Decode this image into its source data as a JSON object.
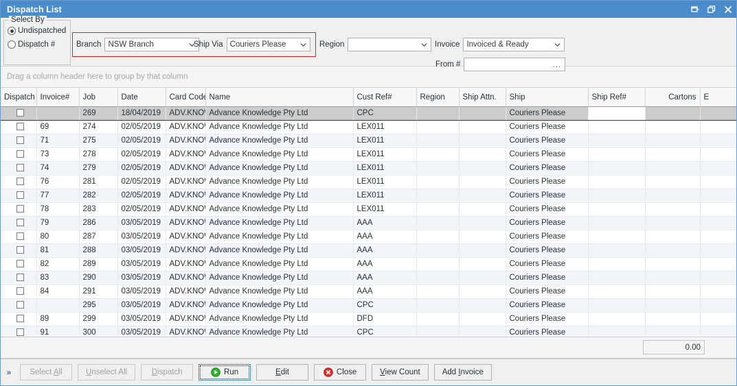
{
  "window": {
    "title": "Dispatch List",
    "controls": [
      {
        "name": "pin-icon",
        "label": "Pin"
      },
      {
        "name": "restore-icon",
        "label": "Restore"
      },
      {
        "name": "close-icon",
        "label": "Close"
      }
    ],
    "titlebar_color": "#4a8ccc"
  },
  "filters": {
    "select_by": {
      "legend": "Select By",
      "options": [
        {
          "label": "Undispatched",
          "checked": true
        },
        {
          "label": "Dispatch #",
          "checked": false
        }
      ]
    },
    "highlight_color": "#e02222",
    "branch": {
      "label": "Branch",
      "value": "NSW Branch"
    },
    "ship_via": {
      "label": "Ship Via",
      "value": "Couriers Please"
    },
    "region": {
      "label": "Region",
      "value": ""
    },
    "invoice": {
      "label": "Invoice",
      "value": "Invoiced & Ready"
    },
    "from_no": {
      "label": "From #",
      "value": "",
      "button": "..."
    }
  },
  "group_panel": {
    "hint": "Drag a column header here to group by that column"
  },
  "grid": {
    "columns": [
      {
        "key": "dispatch",
        "label": "Dispatch",
        "align": "left"
      },
      {
        "key": "invoice",
        "label": "Invoice#",
        "align": "left"
      },
      {
        "key": "job",
        "label": "Job",
        "align": "left"
      },
      {
        "key": "date",
        "label": "Date",
        "align": "left"
      },
      {
        "key": "card_code",
        "label": "Card Code",
        "align": "left"
      },
      {
        "key": "name",
        "label": "Name",
        "align": "left"
      },
      {
        "key": "cust_ref",
        "label": "Cust Ref#",
        "align": "left"
      },
      {
        "key": "region",
        "label": "Region",
        "align": "left"
      },
      {
        "key": "ship_attn",
        "label": "Ship Attn.",
        "align": "left"
      },
      {
        "key": "ship",
        "label": "Ship",
        "align": "left"
      },
      {
        "key": "ship_ref",
        "label": "Ship Ref#",
        "align": "left"
      },
      {
        "key": "cartons",
        "label": "Cartons",
        "align": "right"
      },
      {
        "key": "extra",
        "label": "E",
        "align": "left"
      }
    ],
    "rows": [
      {
        "selected": true,
        "checked": false,
        "invoice": "",
        "job": "269",
        "date": "18/04/2019",
        "card_code": "ADV.KNOW",
        "name": "Advance Knowledge Pty Ltd",
        "cust_ref": "CPC",
        "region": "",
        "ship_attn": "",
        "ship": "Couriers Please",
        "ship_ref": "",
        "cartons": "",
        "extra": ""
      },
      {
        "selected": false,
        "checked": false,
        "invoice": "69",
        "job": "274",
        "date": "02/05/2019",
        "card_code": "ADV.KNOW",
        "name": "Advance Knowledge Pty Ltd",
        "cust_ref": "LEX011",
        "region": "",
        "ship_attn": "",
        "ship": "Couriers Please",
        "ship_ref": "",
        "cartons": "",
        "extra": ""
      },
      {
        "selected": false,
        "checked": false,
        "invoice": "71",
        "job": "275",
        "date": "02/05/2019",
        "card_code": "ADV.KNOW",
        "name": "Advance Knowledge Pty Ltd",
        "cust_ref": "LEX011",
        "region": "",
        "ship_attn": "",
        "ship": "Couriers Please",
        "ship_ref": "",
        "cartons": "",
        "extra": ""
      },
      {
        "selected": false,
        "checked": false,
        "invoice": "73",
        "job": "278",
        "date": "02/05/2019",
        "card_code": "ADV.KNOW",
        "name": "Advance Knowledge Pty Ltd",
        "cust_ref": "LEX011",
        "region": "",
        "ship_attn": "",
        "ship": "Couriers Please",
        "ship_ref": "",
        "cartons": "",
        "extra": ""
      },
      {
        "selected": false,
        "checked": false,
        "invoice": "74",
        "job": "279",
        "date": "02/05/2019",
        "card_code": "ADV.KNOW",
        "name": "Advance Knowledge Pty Ltd",
        "cust_ref": "LEX011",
        "region": "",
        "ship_attn": "",
        "ship": "Couriers Please",
        "ship_ref": "",
        "cartons": "",
        "extra": ""
      },
      {
        "selected": false,
        "checked": false,
        "invoice": "76",
        "job": "281",
        "date": "02/05/2019",
        "card_code": "ADV.KNOW",
        "name": "Advance Knowledge Pty Ltd",
        "cust_ref": "LEX011",
        "region": "",
        "ship_attn": "",
        "ship": "Couriers Please",
        "ship_ref": "",
        "cartons": "",
        "extra": ""
      },
      {
        "selected": false,
        "checked": false,
        "invoice": "77",
        "job": "282",
        "date": "02/05/2019",
        "card_code": "ADV.KNOW",
        "name": "Advance Knowledge Pty Ltd",
        "cust_ref": "LEX011",
        "region": "",
        "ship_attn": "",
        "ship": "Couriers Please",
        "ship_ref": "",
        "cartons": "",
        "extra": ""
      },
      {
        "selected": false,
        "checked": false,
        "invoice": "78",
        "job": "283",
        "date": "02/05/2019",
        "card_code": "ADV.KNOW",
        "name": "Advance Knowledge Pty Ltd",
        "cust_ref": "LEX011",
        "region": "",
        "ship_attn": "",
        "ship": "Couriers Please",
        "ship_ref": "",
        "cartons": "",
        "extra": ""
      },
      {
        "selected": false,
        "checked": false,
        "invoice": "79",
        "job": "286",
        "date": "03/05/2019",
        "card_code": "ADV.KNOW",
        "name": "Advance Knowledge Pty Ltd",
        "cust_ref": "AAA",
        "region": "",
        "ship_attn": "",
        "ship": "Couriers Please",
        "ship_ref": "",
        "cartons": "",
        "extra": ""
      },
      {
        "selected": false,
        "checked": false,
        "invoice": "80",
        "job": "287",
        "date": "03/05/2019",
        "card_code": "ADV.KNOW",
        "name": "Advance Knowledge Pty Ltd",
        "cust_ref": "AAA",
        "region": "",
        "ship_attn": "",
        "ship": "Couriers Please",
        "ship_ref": "",
        "cartons": "",
        "extra": ""
      },
      {
        "selected": false,
        "checked": false,
        "invoice": "81",
        "job": "288",
        "date": "03/05/2019",
        "card_code": "ADV.KNOW",
        "name": "Advance Knowledge Pty Ltd",
        "cust_ref": "AAA",
        "region": "",
        "ship_attn": "",
        "ship": "Couriers Please",
        "ship_ref": "",
        "cartons": "",
        "extra": ""
      },
      {
        "selected": false,
        "checked": false,
        "invoice": "82",
        "job": "289",
        "date": "03/05/2019",
        "card_code": "ADV.KNOW",
        "name": "Advance Knowledge Pty Ltd",
        "cust_ref": "AAA",
        "region": "",
        "ship_attn": "",
        "ship": "Couriers Please",
        "ship_ref": "",
        "cartons": "",
        "extra": ""
      },
      {
        "selected": false,
        "checked": false,
        "invoice": "83",
        "job": "290",
        "date": "03/05/2019",
        "card_code": "ADV.KNOW",
        "name": "Advance Knowledge Pty Ltd",
        "cust_ref": "AAA",
        "region": "",
        "ship_attn": "",
        "ship": "Couriers Please",
        "ship_ref": "",
        "cartons": "",
        "extra": ""
      },
      {
        "selected": false,
        "checked": false,
        "invoice": "84",
        "job": "291",
        "date": "03/05/2019",
        "card_code": "ADV.KNOW",
        "name": "Advance Knowledge Pty Ltd",
        "cust_ref": "AAA",
        "region": "",
        "ship_attn": "",
        "ship": "Couriers Please",
        "ship_ref": "",
        "cartons": "",
        "extra": ""
      },
      {
        "selected": false,
        "checked": false,
        "invoice": "",
        "job": "295",
        "date": "03/05/2019",
        "card_code": "ADV.KNOW",
        "name": "Advance Knowledge Pty Ltd",
        "cust_ref": "CPC",
        "region": "",
        "ship_attn": "",
        "ship": "Couriers Please",
        "ship_ref": "",
        "cartons": "",
        "extra": ""
      },
      {
        "selected": false,
        "checked": false,
        "invoice": "89",
        "job": "299",
        "date": "03/05/2019",
        "card_code": "ADV.KNOW",
        "name": "Advance Knowledge Pty Ltd",
        "cust_ref": "DFD",
        "region": "",
        "ship_attn": "",
        "ship": "Couriers Please",
        "ship_ref": "",
        "cartons": "",
        "extra": ""
      },
      {
        "selected": false,
        "checked": false,
        "invoice": "91",
        "job": "300",
        "date": "03/05/2019",
        "card_code": "ADV.KNOW",
        "name": "Advance Knowledge Pty Ltd",
        "cust_ref": "CPC",
        "region": "",
        "ship_attn": "",
        "ship": "Couriers Please",
        "ship_ref": "",
        "cartons": "",
        "extra": ""
      }
    ]
  },
  "summary": {
    "total": "0.00"
  },
  "buttons": {
    "overflow": "»",
    "items": [
      {
        "name": "select-all-button",
        "label": "Select All",
        "underline": "A",
        "disabled": true,
        "focused": false,
        "icon": ""
      },
      {
        "name": "unselect-all-button",
        "label": "Unselect All",
        "underline": "U",
        "disabled": true,
        "focused": false,
        "icon": ""
      },
      {
        "name": "dispatch-button",
        "label": "Dispatch",
        "underline": "D",
        "disabled": true,
        "focused": false,
        "icon": ""
      },
      {
        "name": "run-button",
        "label": "Run",
        "underline": "",
        "disabled": false,
        "focused": true,
        "icon": "play-icon"
      },
      {
        "name": "edit-button",
        "label": "Edit",
        "underline": "E",
        "disabled": false,
        "focused": false,
        "icon": ""
      },
      {
        "name": "close-button",
        "label": "Close",
        "underline": "",
        "disabled": false,
        "focused": false,
        "icon": "stop-icon"
      },
      {
        "name": "view-count-button",
        "label": "View Count",
        "underline": "V",
        "disabled": false,
        "focused": false,
        "icon": ""
      },
      {
        "name": "add-invoice-button",
        "label": "Add Invoice",
        "underline": "I",
        "disabled": false,
        "focused": false,
        "icon": ""
      }
    ]
  }
}
